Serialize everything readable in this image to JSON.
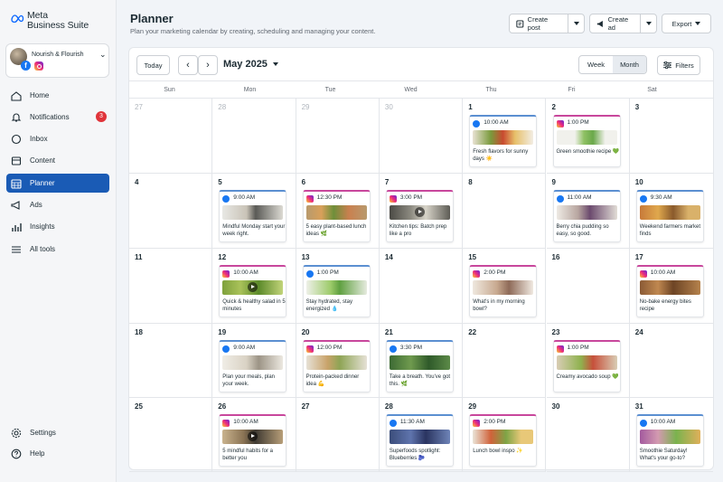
{
  "app": {
    "logo_line1": "Meta",
    "logo_line2": "Business Suite"
  },
  "account": {
    "name": "Nourish & Flourish"
  },
  "nav": [
    {
      "label": "Home",
      "icon": "home-icon"
    },
    {
      "label": "Notifications",
      "icon": "bell-icon",
      "badge": "3"
    },
    {
      "label": "Inbox",
      "icon": "chat-icon"
    },
    {
      "label": "Content",
      "icon": "content-icon"
    },
    {
      "label": "Planner",
      "icon": "calendar-icon",
      "active": true
    },
    {
      "label": "Ads",
      "icon": "megaphone-icon"
    },
    {
      "label": "Insights",
      "icon": "bar-chart-icon"
    },
    {
      "label": "All tools",
      "icon": "menu-icon"
    }
  ],
  "nav_bottom": [
    {
      "label": "Settings",
      "icon": "gear-icon"
    },
    {
      "label": "Help",
      "icon": "help-icon"
    }
  ],
  "header": {
    "title": "Planner",
    "subtitle": "Plan your marketing calendar by creating, scheduling and managing your content.",
    "create_post": "Create post",
    "create_ad": "Create ad",
    "export": "Export"
  },
  "toolbar": {
    "today": "Today",
    "month_label": "May 2025",
    "week": "Week",
    "month": "Month",
    "filters": "Filters",
    "active_view": "Month"
  },
  "weekdays": [
    "Sun",
    "Mon",
    "Tue",
    "Wed",
    "Thu",
    "Fri",
    "Sat"
  ],
  "colors": {
    "accent": "#1a5bb5",
    "facebook": "#1877f2",
    "badge": "#e0343a"
  },
  "days": [
    {
      "n": "27",
      "dim": true
    },
    {
      "n": "28",
      "dim": true
    },
    {
      "n": "29",
      "dim": true
    },
    {
      "n": "30",
      "dim": true
    },
    {
      "n": "1",
      "post": {
        "platform": "fb",
        "time": "10:00 AM",
        "caption": "Fresh flavors for sunny days ☀️",
        "img": "salad"
      }
    },
    {
      "n": "2",
      "post": {
        "platform": "ig",
        "time": "1:00 PM",
        "caption": "Green smoothie recipe 💚",
        "img": "smoothie"
      }
    },
    {
      "n": "3"
    },
    {
      "n": "4"
    },
    {
      "n": "5",
      "post": {
        "platform": "fb",
        "time": "9:00 AM",
        "caption": "Mindful Monday start your week right.",
        "img": "yoga"
      }
    },
    {
      "n": "6",
      "post": {
        "platform": "ig",
        "time": "12:30 PM",
        "caption": "5 easy plant-based lunch ideas 🌿",
        "img": "bowls"
      }
    },
    {
      "n": "7",
      "post": {
        "platform": "reel",
        "time": "3:00 PM",
        "caption": "Kitchen tips: Batch prep like a pro",
        "img": "kitchen",
        "video": true
      }
    },
    {
      "n": "8"
    },
    {
      "n": "9",
      "post": {
        "platform": "fb",
        "time": "11:00 AM",
        "caption": "Berry chia pudding so easy, so good.",
        "img": "chia"
      }
    },
    {
      "n": "10",
      "post": {
        "platform": "fb",
        "time": "9:30 AM",
        "caption": "Weekend farmers market finds",
        "img": "market"
      }
    },
    {
      "n": "11"
    },
    {
      "n": "12",
      "post": {
        "platform": "reel",
        "time": "10:00 AM",
        "caption": "Quick & healthy salad in 5 minutes",
        "img": "greens",
        "video": true
      }
    },
    {
      "n": "13",
      "post": {
        "platform": "fb",
        "time": "1:00 PM",
        "caption": "Stay hydrated, stay energized 💧",
        "img": "juice"
      }
    },
    {
      "n": "14"
    },
    {
      "n": "15",
      "post": {
        "platform": "ig",
        "time": "2:00 PM",
        "caption": "What's in my morning bowl?",
        "img": "morning"
      }
    },
    {
      "n": "16"
    },
    {
      "n": "17",
      "post": {
        "platform": "reel",
        "time": "10:00 AM",
        "caption": "No-bake energy bites recipe",
        "img": "bites"
      }
    },
    {
      "n": "18"
    },
    {
      "n": "19",
      "post": {
        "platform": "fb",
        "time": "9:00 AM",
        "caption": "Plan your meals, plan your week.",
        "img": "plan"
      }
    },
    {
      "n": "20",
      "post": {
        "platform": "ig",
        "time": "12:00 PM",
        "caption": "Protein-packed dinner idea 💪",
        "img": "dinner"
      }
    },
    {
      "n": "21",
      "post": {
        "platform": "fb",
        "time": "3:30 PM",
        "caption": "Take a breath. You've got this. 🌿",
        "img": "forest"
      }
    },
    {
      "n": "22"
    },
    {
      "n": "23",
      "post": {
        "platform": "ig",
        "time": "1:00 PM",
        "caption": "Creamy avocado soup 💚",
        "img": "soup"
      }
    },
    {
      "n": "24"
    },
    {
      "n": "25"
    },
    {
      "n": "26",
      "post": {
        "platform": "reel",
        "time": "10:00 AM",
        "caption": "5 mindful habits for a better you",
        "img": "habits",
        "video": true
      }
    },
    {
      "n": "27"
    },
    {
      "n": "28",
      "post": {
        "platform": "fb",
        "time": "11:30 AM",
        "caption": "Superfoods spotlight: Blueberries 🫐",
        "img": "blueberry"
      }
    },
    {
      "n": "29",
      "post": {
        "platform": "ig",
        "time": "2:00 PM",
        "caption": "Lunch bowl inspo ✨",
        "img": "lunchbowl"
      }
    },
    {
      "n": "30"
    },
    {
      "n": "31",
      "post": {
        "platform": "fb",
        "time": "10:00 AM",
        "caption": "Smoothie Saturday! What's your go-to?",
        "img": "smoothies"
      }
    }
  ]
}
